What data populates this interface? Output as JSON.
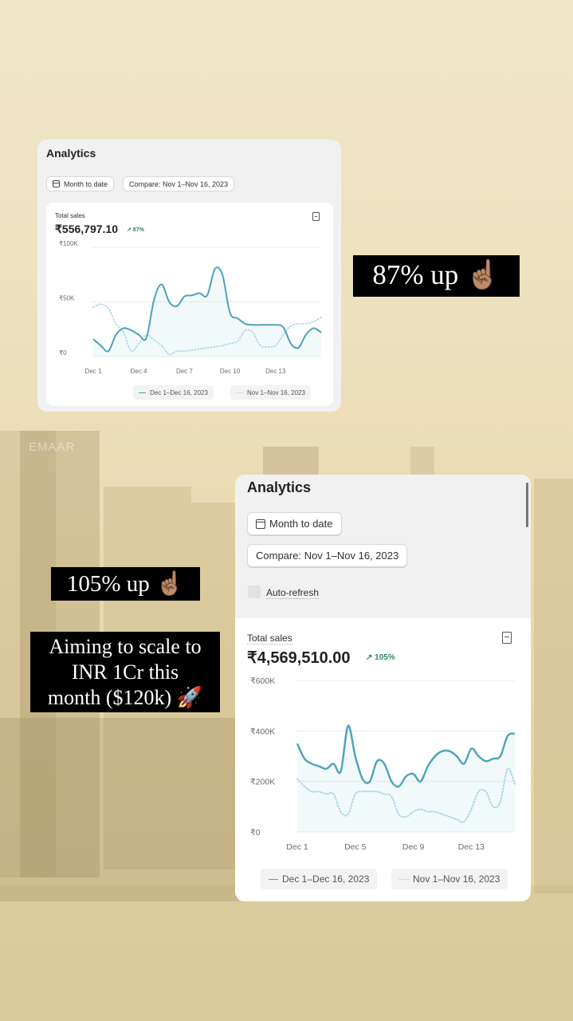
{
  "card_small": {
    "title": "Analytics",
    "date_range_button": "Month to date",
    "compare_button": "Compare: Nov 1–Nov 16, 2023",
    "metric_label": "Total sales",
    "metric_value": "₹556,797.10",
    "metric_change": "↗ 87%",
    "legend_current": "Dec 1–Dec 16, 2023",
    "legend_previous": "Nov 1–Nov 16, 2023"
  },
  "card_large": {
    "title": "Analytics",
    "date_range_button": "Month to date",
    "compare_button": "Compare: Nov 1–Nov 16, 2023",
    "auto_refresh_label": "Auto-refresh",
    "metric_label": "Total sales",
    "metric_value": "₹4,569,510.00",
    "metric_change": "↗ 105%",
    "legend_current": "Dec 1–Dec 16, 2023",
    "legend_previous": "Nov 1–Nov 16, 2023"
  },
  "captions": {
    "growth_small": "87% up ☝🏽",
    "growth_large": "105% up ☝🏽",
    "goal_line1": "Aiming to scale to",
    "goal_line2": "INR 1Cr this",
    "goal_line3": "month ($120k) 🚀"
  },
  "background_sign": "EMAAR",
  "colors": {
    "current_series": "#4ba3bb",
    "previous_series": "#a9d6e2",
    "positive_change": "#2f8a5a"
  },
  "chart_data": [
    {
      "type": "line",
      "ylabel": "",
      "xlabel": "",
      "ylim": [
        0,
        100000
      ],
      "y_ticks": [
        "₹100K",
        "₹50K",
        "₹0"
      ],
      "y_tick_values": [
        100000,
        50000,
        0
      ],
      "x_ticks": [
        "Dec 1",
        "Dec 4",
        "Dec 7",
        "Dec 10",
        "Dec 13"
      ],
      "x_tick_values": [
        1,
        4,
        7,
        10,
        13
      ],
      "x": [
        1,
        1.5,
        2,
        2.5,
        3,
        3.5,
        4,
        4.5,
        5,
        5.5,
        6,
        6.5,
        7,
        7.5,
        8,
        8.5,
        9,
        9.5,
        10,
        10.5,
        11,
        11.5,
        12,
        12.5,
        13,
        13.5,
        14,
        14.5,
        15,
        15.5,
        16
      ],
      "series": [
        {
          "name": "Dec 1–Dec 16, 2023",
          "style": "solid",
          "values": [
            16000,
            10000,
            5000,
            20000,
            26000,
            24000,
            20000,
            17000,
            52000,
            66000,
            50000,
            46000,
            55000,
            56000,
            58000,
            56000,
            80000,
            75000,
            40000,
            35000,
            30000,
            29000,
            29000,
            29000,
            29000,
            27000,
            12000,
            8000,
            20000,
            26000,
            22000
          ]
        },
        {
          "name": "Nov 1–Nov 16, 2023",
          "style": "dotted",
          "values": [
            45000,
            48000,
            44000,
            30000,
            22000,
            5000,
            12000,
            20000,
            15000,
            10000,
            2000,
            5000,
            5000,
            6000,
            7000,
            8000,
            9000,
            10000,
            12000,
            14000,
            24000,
            22000,
            10000,
            9000,
            10000,
            20000,
            28000,
            30000,
            30000,
            32000,
            36000
          ]
        }
      ]
    },
    {
      "type": "line",
      "ylabel": "",
      "xlabel": "",
      "ylim": [
        0,
        600000
      ],
      "y_ticks": [
        "₹600K",
        "₹400K",
        "₹200K",
        "₹0"
      ],
      "y_tick_values": [
        600000,
        400000,
        200000,
        0
      ],
      "x_ticks": [
        "Dec 1",
        "Dec 5",
        "Dec 9",
        "Dec 13"
      ],
      "x_tick_values": [
        1,
        5,
        9,
        13
      ],
      "x": [
        1,
        1.5,
        2,
        2.5,
        3,
        3.5,
        4,
        4.5,
        5,
        5.5,
        6,
        6.5,
        7,
        7.5,
        8,
        8.5,
        9,
        9.5,
        10,
        10.5,
        11,
        11.5,
        12,
        12.5,
        13,
        13.5,
        14,
        14.5,
        15,
        15.5,
        16
      ],
      "series": [
        {
          "name": "Dec 1–Dec 16, 2023",
          "style": "solid",
          "values": [
            350000,
            290000,
            270000,
            260000,
            250000,
            270000,
            240000,
            420000,
            300000,
            210000,
            200000,
            280000,
            270000,
            200000,
            180000,
            220000,
            230000,
            200000,
            260000,
            300000,
            320000,
            320000,
            300000,
            270000,
            330000,
            300000,
            280000,
            290000,
            300000,
            380000,
            390000
          ]
        },
        {
          "name": "Nov 1–Nov 16, 2023",
          "style": "dotted",
          "values": [
            210000,
            180000,
            160000,
            160000,
            150000,
            150000,
            80000,
            70000,
            150000,
            160000,
            160000,
            160000,
            150000,
            140000,
            70000,
            60000,
            80000,
            90000,
            80000,
            80000,
            70000,
            60000,
            50000,
            40000,
            90000,
            160000,
            160000,
            100000,
            120000,
            250000,
            190000
          ]
        }
      ]
    }
  ]
}
